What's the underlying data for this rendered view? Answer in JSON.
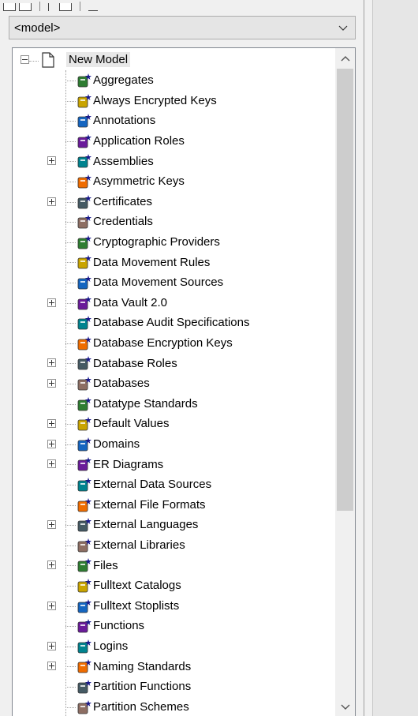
{
  "combo": {
    "value": "<model>",
    "icon": "chevron-down-icon"
  },
  "tree": {
    "root": {
      "label": "New Model",
      "expanded": true,
      "icon": "document-icon"
    },
    "items": [
      {
        "label": "Aggregates",
        "expandable": false,
        "icon": "aggregate-icon"
      },
      {
        "label": "Always Encrypted Keys",
        "expandable": false,
        "icon": "key-group-icon"
      },
      {
        "label": "Annotations",
        "expandable": false,
        "icon": "annotation-icon"
      },
      {
        "label": "Application Roles",
        "expandable": false,
        "icon": "application-role-icon"
      },
      {
        "label": "Assemblies",
        "expandable": true,
        "icon": "assembly-icon"
      },
      {
        "label": "Asymmetric Keys",
        "expandable": false,
        "icon": "asymmetric-key-icon"
      },
      {
        "label": "Certificates",
        "expandable": true,
        "icon": "certificate-icon"
      },
      {
        "label": "Credentials",
        "expandable": false,
        "icon": "credential-icon"
      },
      {
        "label": "Cryptographic Providers",
        "expandable": false,
        "icon": "crypto-provider-icon"
      },
      {
        "label": "Data Movement Rules",
        "expandable": false,
        "icon": "data-movement-rule-icon"
      },
      {
        "label": "Data Movement Sources",
        "expandable": false,
        "icon": "data-movement-source-icon"
      },
      {
        "label": "Data Vault 2.0",
        "expandable": true,
        "icon": "data-vault-icon"
      },
      {
        "label": "Database Audit Specifications",
        "expandable": false,
        "icon": "audit-spec-icon"
      },
      {
        "label": "Database Encryption Keys",
        "expandable": false,
        "icon": "encryption-key-icon"
      },
      {
        "label": "Database Roles",
        "expandable": true,
        "icon": "database-role-icon"
      },
      {
        "label": "Databases",
        "expandable": true,
        "icon": "database-icon"
      },
      {
        "label": "Datatype Standards",
        "expandable": false,
        "icon": "datatype-standard-icon"
      },
      {
        "label": "Default Values",
        "expandable": true,
        "icon": "default-value-icon"
      },
      {
        "label": "Domains",
        "expandable": true,
        "icon": "domain-icon"
      },
      {
        "label": "ER Diagrams",
        "expandable": true,
        "icon": "er-diagram-icon"
      },
      {
        "label": "External Data Sources",
        "expandable": false,
        "icon": "external-data-source-icon"
      },
      {
        "label": "External File Formats",
        "expandable": false,
        "icon": "external-file-format-icon"
      },
      {
        "label": "External Languages",
        "expandable": true,
        "icon": "external-language-icon"
      },
      {
        "label": "External Libraries",
        "expandable": false,
        "icon": "external-library-icon"
      },
      {
        "label": "Files",
        "expandable": true,
        "icon": "file-icon"
      },
      {
        "label": "Fulltext Catalogs",
        "expandable": false,
        "icon": "fulltext-catalog-icon"
      },
      {
        "label": "Fulltext Stoplists",
        "expandable": true,
        "icon": "fulltext-stoplist-icon"
      },
      {
        "label": "Functions",
        "expandable": false,
        "icon": "function-icon"
      },
      {
        "label": "Logins",
        "expandable": true,
        "icon": "login-icon"
      },
      {
        "label": "Naming Standards",
        "expandable": true,
        "icon": "naming-standard-icon"
      },
      {
        "label": "Partition Functions",
        "expandable": false,
        "icon": "partition-function-icon"
      },
      {
        "label": "Partition Schemes",
        "expandable": false,
        "icon": "partition-scheme-icon"
      }
    ]
  },
  "scrollbar": {
    "up_icon": "chevron-up-icon",
    "down_icon": "chevron-down-icon"
  },
  "colors": {
    "window_bg": "#f0f0f0",
    "tree_bg": "#ffffff",
    "scroll_thumb": "#cdcdcd",
    "selection_bg": "#e8e8e8"
  }
}
